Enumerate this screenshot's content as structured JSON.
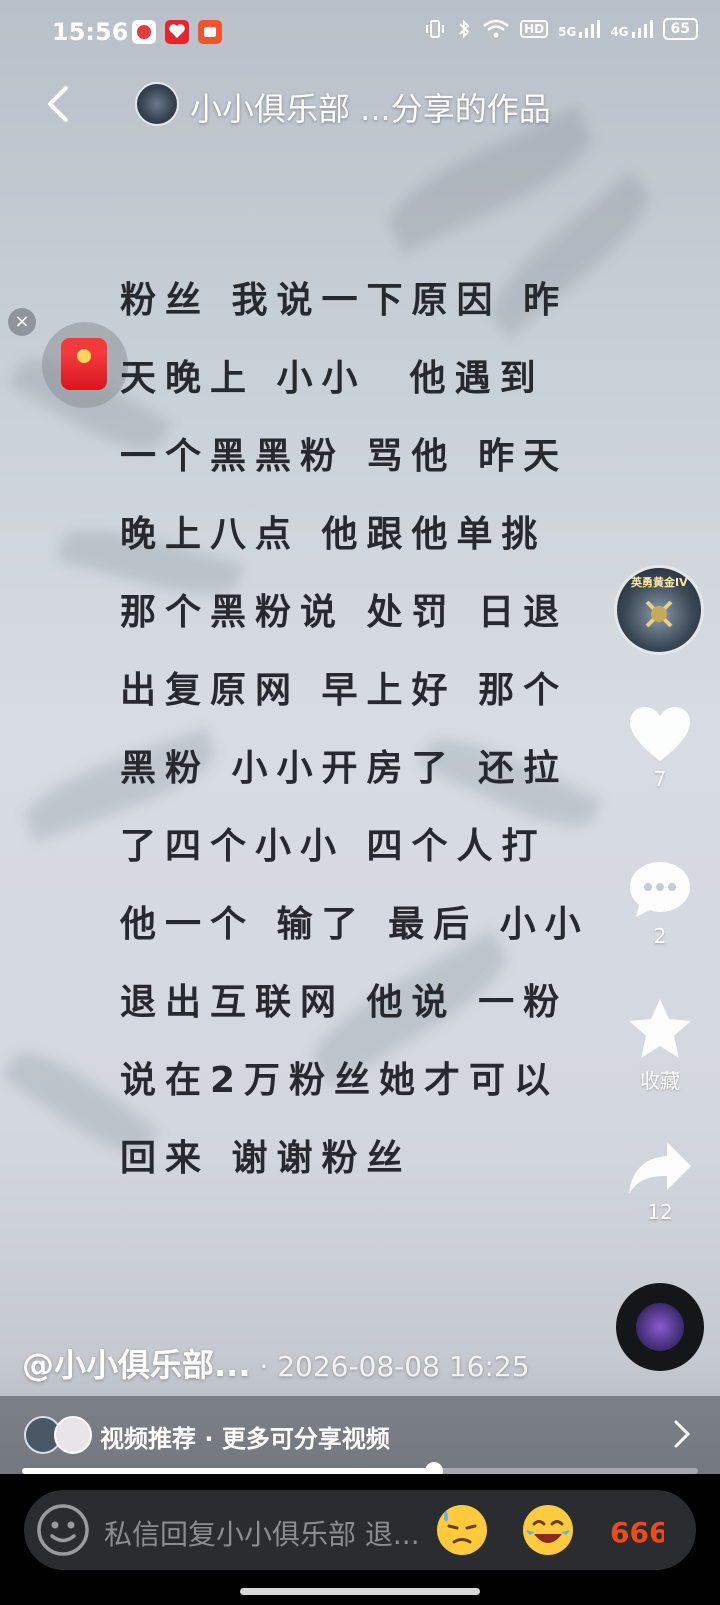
{
  "status_bar": {
    "time": "15:56",
    "network_5g": "5G",
    "network_4g": "4G",
    "hd": "HD",
    "battery": "65"
  },
  "header": {
    "title": "小小俱乐部 ...分享的作品"
  },
  "lyrics": [
    "粉丝 我说一下原因 昨",
    "天晚上 小小  他遇到",
    "一个黑黑粉 骂他 昨天",
    "晚上八点 他跟他单挑",
    "那个黑粉说 处罚 日退",
    "出复原网 早上好 那个",
    "黑粉 小小开房了 还拉",
    "了四个小小 四个人打",
    "他一个 输了 最后 小小",
    "退出互联网 他说 一粉",
    "说在2万粉丝她才可以",
    "回来 谢谢粉丝"
  ],
  "floating": {
    "close_symbol": "×"
  },
  "side_actions": {
    "avatar_badge": "英勇黄金IV",
    "like_count": "7",
    "comment_count": "2",
    "favorite_label": "收藏",
    "share_count": "12"
  },
  "author": {
    "name": "@小小俱乐部...",
    "separator": " · ",
    "datetime": "2026-08-08 16:25"
  },
  "recommend": {
    "text": "视频推荐 · 更多可分享视频"
  },
  "progress": {
    "fraction": 0.61
  },
  "bottom_bar": {
    "placeholder": "私信回复小小俱乐部 退..."
  },
  "icons": {
    "back": "back-arrow-icon",
    "like": "heart-icon",
    "comment": "comment-icon",
    "favorite": "star-icon",
    "share": "share-icon",
    "emoji": "smile-icon"
  }
}
